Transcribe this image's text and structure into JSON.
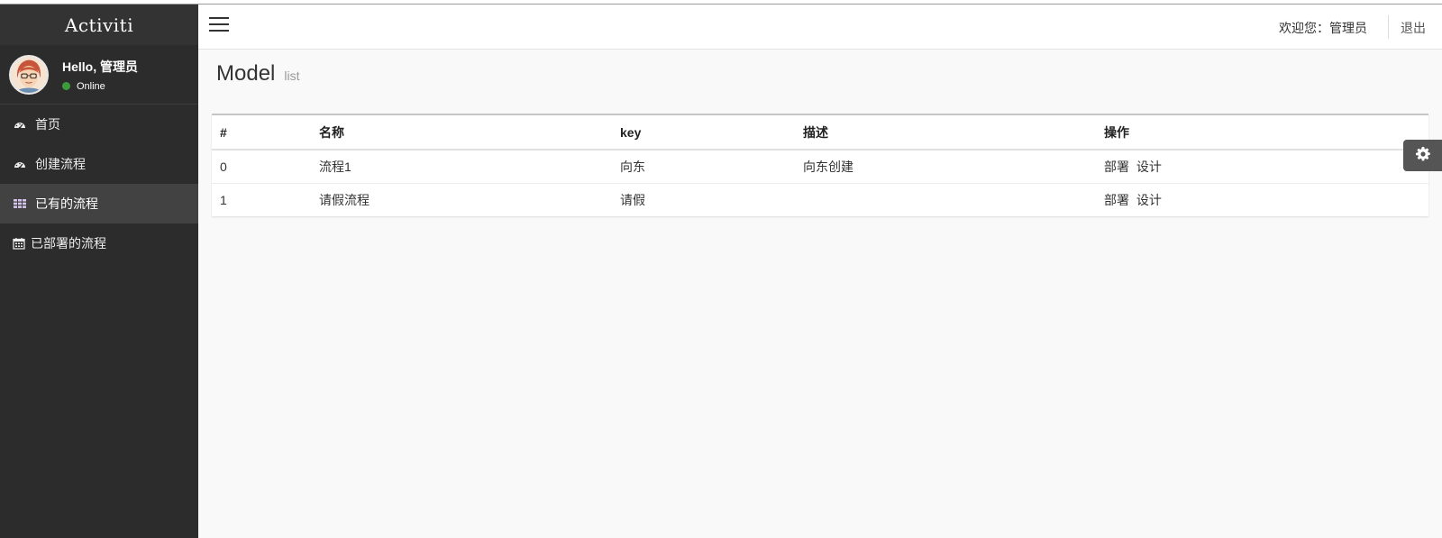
{
  "app": {
    "brand": "Activiti"
  },
  "user": {
    "hello": "Hello, 管理员",
    "status": "Online"
  },
  "sidebar": {
    "items": [
      {
        "label": "首页",
        "icon": "dashboard-icon",
        "active": false
      },
      {
        "label": "创建流程",
        "icon": "dashboard-icon",
        "active": false
      },
      {
        "label": "已有的流程",
        "icon": "grid-icon",
        "active": true
      },
      {
        "label": "已部署的流程",
        "icon": "calendar-icon",
        "active": false
      }
    ]
  },
  "header": {
    "welcome": "欢迎您：管理员",
    "logout": "退出"
  },
  "page": {
    "title": "Model",
    "subtitle": "list"
  },
  "table": {
    "columns": [
      "#",
      "名称",
      "key",
      "描述",
      "操作"
    ],
    "rows": [
      {
        "index": "0",
        "name": "流程1",
        "key": "向东",
        "description": "向东创建",
        "deploy": "部署",
        "design": "设计"
      },
      {
        "index": "1",
        "name": "请假流程",
        "key": "请假",
        "description": "",
        "deploy": "部署",
        "design": "设计"
      }
    ]
  },
  "colors": {
    "sidebar": "#2c2c2c",
    "sidebar_active": "#424242",
    "online": "#3c9c3c"
  }
}
